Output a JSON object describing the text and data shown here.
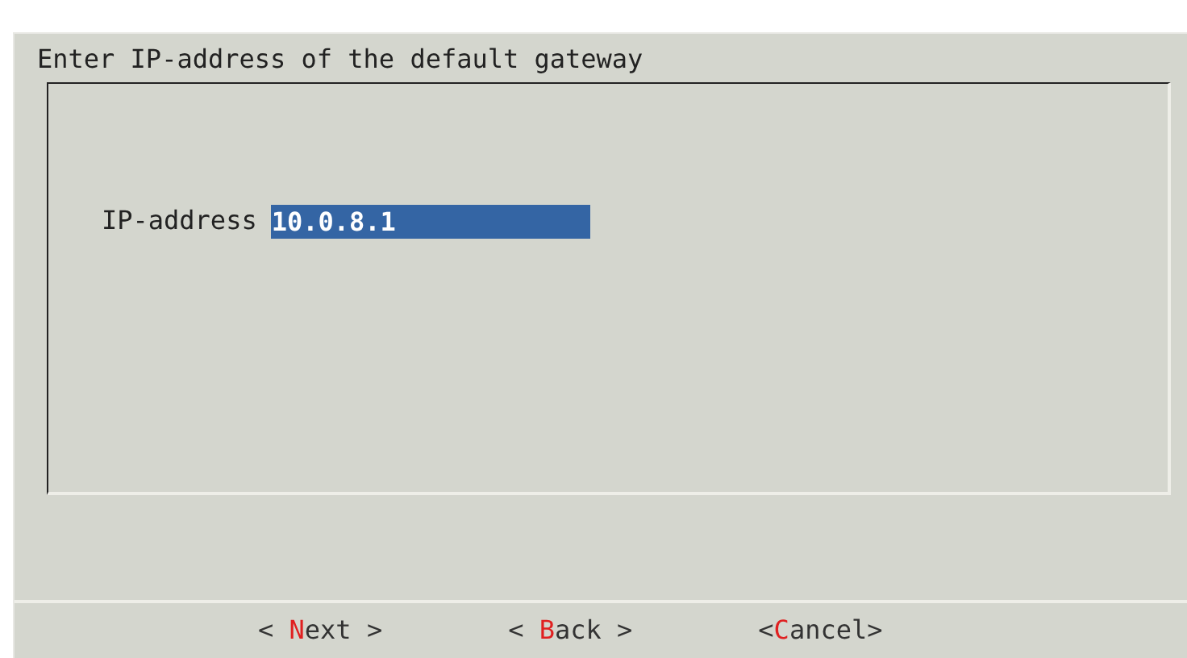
{
  "dialog": {
    "title": "Enter IP-address of the default gateway"
  },
  "field": {
    "label": "IP-address",
    "value": "10.0.8.1",
    "focused": true
  },
  "buttons": [
    {
      "prefix": "< ",
      "hotkey": "N",
      "suffix": "ext >"
    },
    {
      "prefix": "< ",
      "hotkey": "B",
      "suffix": "ack >"
    },
    {
      "prefix": "<",
      "hotkey": "C",
      "suffix": "ancel>"
    }
  ]
}
